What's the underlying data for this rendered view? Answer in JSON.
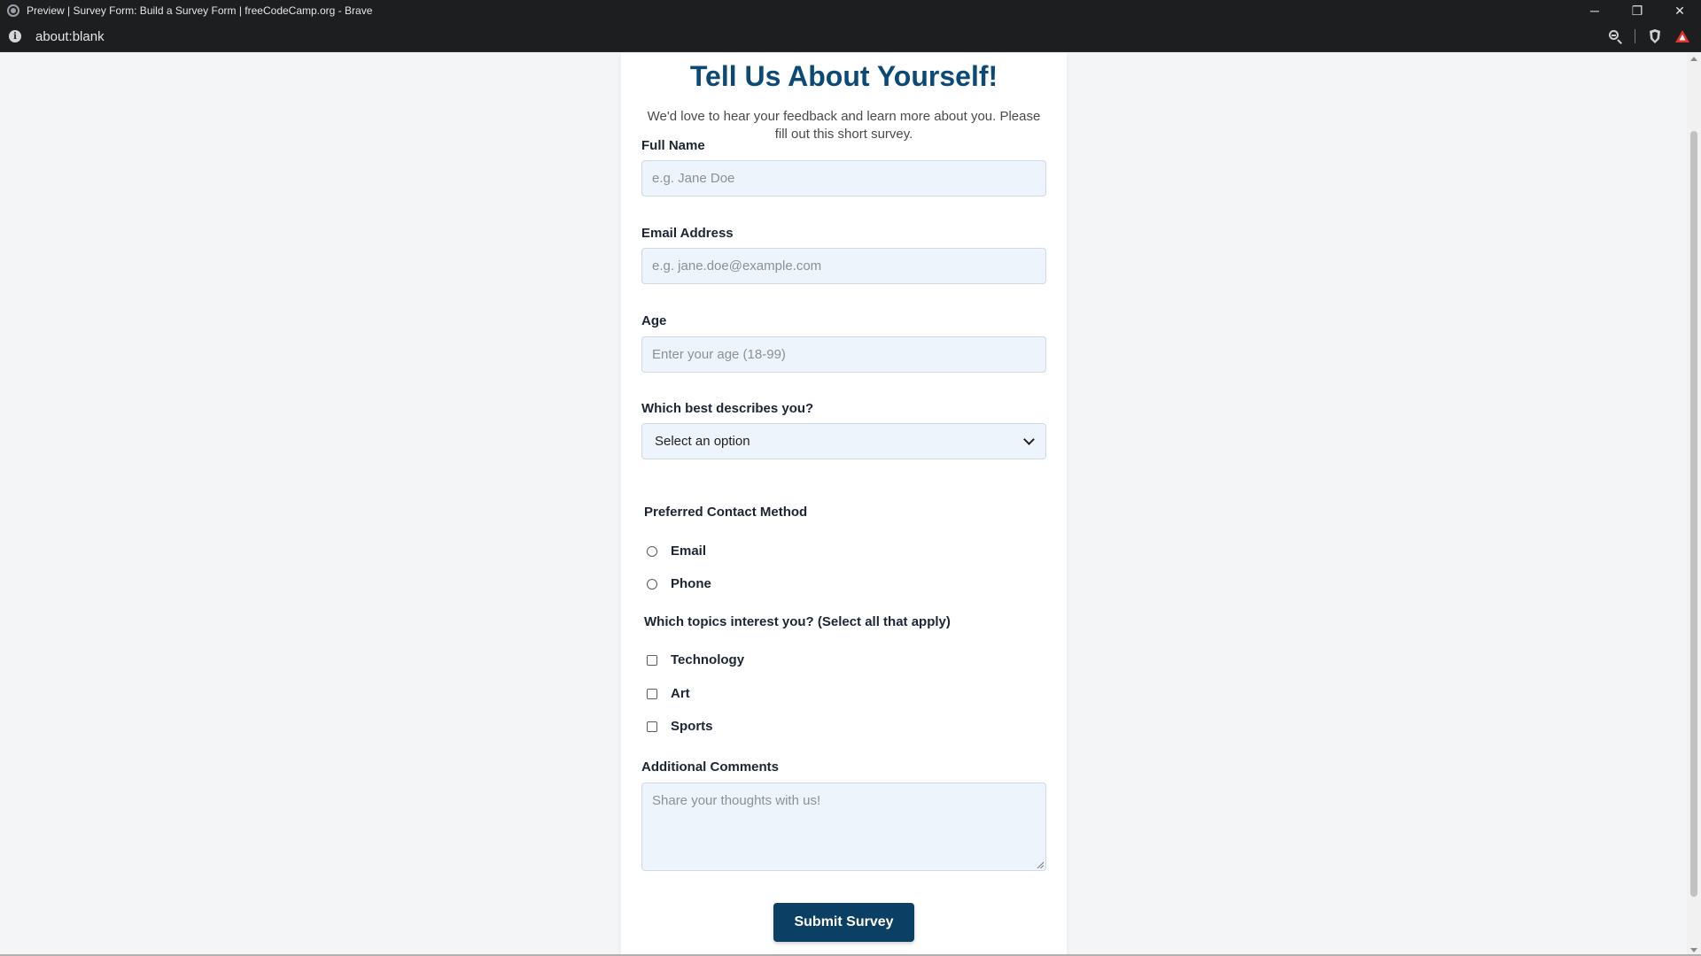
{
  "browser": {
    "window_title": "Preview | Survey Form: Build a Survey Form | freeCodeCamp.org - Brave",
    "url": "about:blank",
    "minimize": "─",
    "restore": "❐",
    "close": "✕"
  },
  "form": {
    "title": "Tell Us About Yourself!",
    "description": "We'd love to hear your feedback and learn more about you. Please fill out this short survey.",
    "name": {
      "label": "Full Name",
      "placeholder": "e.g. Jane Doe"
    },
    "email": {
      "label": "Email Address",
      "placeholder": "e.g. jane.doe@example.com"
    },
    "age": {
      "label": "Age",
      "placeholder": "Enter your age (18-99)"
    },
    "role": {
      "label": "Which best describes you?",
      "selected": "Select an option"
    },
    "contact": {
      "title": "Preferred Contact Method",
      "options": [
        "Email",
        "Phone"
      ]
    },
    "topics": {
      "title": "Which topics interest you? (Select all that apply)",
      "options": [
        "Technology",
        "Art",
        "Sports"
      ]
    },
    "comments": {
      "label": "Additional Comments",
      "placeholder": "Share your thoughts with us!"
    },
    "submit_label": "Submit Survey"
  },
  "colors": {
    "heading": "#0b4a77",
    "button": "#0b3f63",
    "field_bg": "#eef4fb",
    "page_bg": "#f4f5f7"
  }
}
